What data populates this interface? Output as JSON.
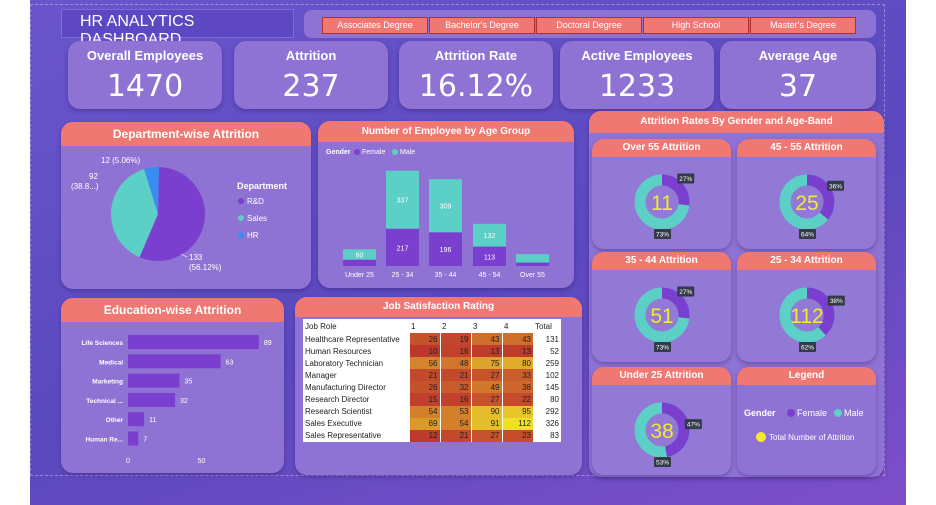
{
  "header": {
    "title": "HR ANALYTICS DASHBOARD"
  },
  "education_slicer": [
    "Associates Degree",
    "Bachelor's Degree",
    "Doctoral Degree",
    "High School",
    "Master's Degree"
  ],
  "kpis": [
    {
      "label": "Overall Employees",
      "value": "1470"
    },
    {
      "label": "Attrition",
      "value": "237"
    },
    {
      "label": "Attrition Rate",
      "value": "16.12%"
    },
    {
      "label": "Active Employees",
      "value": "1233"
    },
    {
      "label": "Average Age",
      "value": "37"
    }
  ],
  "colors": {
    "rd": "#7b3fd0",
    "sales": "#5ccfc6",
    "hr": "#3a8df0",
    "female": "#7b3fd0",
    "male": "#5ccfc6",
    "header": "#f07873",
    "total": "#f2ea2a"
  },
  "chart_data": [
    {
      "type": "pie",
      "title": "Department-wise Attrition",
      "legend_title": "Department",
      "categories": [
        "R&D",
        "Sales",
        "HR"
      ],
      "values": [
        133,
        92,
        12
      ],
      "labels": [
        "133\n(56.12%)",
        "92\n(38.8...)",
        "12 (5.06%)"
      ]
    },
    {
      "type": "bar",
      "title": "Number of Employee by Age Group",
      "legend_title": "Gender",
      "categories": [
        "Under 25",
        "25 - 34",
        "35 - 44",
        "45 - 54",
        "Over 55"
      ],
      "series": [
        {
          "name": "Female",
          "values": [
            37,
            217,
            196,
            113,
            20
          ]
        },
        {
          "name": "Male",
          "values": [
            60,
            337,
            309,
            132,
            49
          ]
        }
      ],
      "data_labels": {
        "Female": [
          "",
          "217",
          "196",
          "113",
          ""
        ],
        "Male": [
          "60",
          "337",
          "309",
          "132",
          ""
        ]
      }
    },
    {
      "type": "bar",
      "title": "Education-wise Attrition",
      "categories": [
        "Life Sciences",
        "Medical",
        "Marketing",
        "Technical ...",
        "Other",
        "Human Re..."
      ],
      "values": [
        89,
        63,
        35,
        32,
        11,
        7
      ],
      "xticks": [
        "0",
        "50"
      ]
    },
    {
      "type": "table",
      "title": "Job Satisfaction Rating",
      "columns": [
        "Job Role",
        "1",
        "2",
        "3",
        "4",
        "Total"
      ],
      "rows": [
        [
          "Healthcare Representative",
          "26",
          "19",
          "43",
          "43",
          "131"
        ],
        [
          "Human Resources",
          "10",
          "16",
          "13",
          "13",
          "52"
        ],
        [
          "Laboratory Technician",
          "56",
          "48",
          "75",
          "80",
          "259"
        ],
        [
          "Manager",
          "21",
          "21",
          "27",
          "33",
          "102"
        ],
        [
          "Manufacturing Director",
          "26",
          "32",
          "49",
          "38",
          "145"
        ],
        [
          "Research Director",
          "15",
          "16",
          "27",
          "22",
          "80"
        ],
        [
          "Research Scientist",
          "54",
          "53",
          "90",
          "95",
          "292"
        ],
        [
          "Sales Executive",
          "69",
          "54",
          "91",
          "112",
          "326"
        ],
        [
          "Sales Representative",
          "12",
          "21",
          "27",
          "23",
          "83"
        ]
      ]
    },
    {
      "type": "pie",
      "title": "Attrition Rates By Gender and Age-Band",
      "panels": [
        {
          "title": "Over 55 Attrition",
          "total": "11",
          "female_pct": 27,
          "male_pct": 73,
          "female_label": "27%",
          "male_label": "73%"
        },
        {
          "title": "45 - 55 Attrition",
          "total": "25",
          "female_pct": 36,
          "male_pct": 64,
          "female_label": "36%",
          "male_label": "64%"
        },
        {
          "title": "35 - 44 Attrition",
          "total": "51",
          "female_pct": 27,
          "male_pct": 73,
          "female_label": "27%",
          "male_label": "73%"
        },
        {
          "title": "25 - 34 Attrition",
          "total": "112",
          "female_pct": 38,
          "male_pct": 62,
          "female_label": "38%",
          "male_label": "62%"
        },
        {
          "title": "Under 25 Attrition",
          "total": "38",
          "female_pct": 47,
          "male_pct": 53,
          "female_label": "47%",
          "male_label": "53%"
        }
      ]
    }
  ],
  "legend_card": {
    "title": "Legend",
    "gender_label": "Gender",
    "female": "Female",
    "male": "Male",
    "total_label": "Total Number of Attrition"
  }
}
